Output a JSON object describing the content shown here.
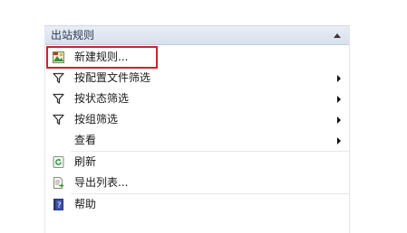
{
  "pane": {
    "title": "出站规则",
    "items": [
      {
        "label": "新建规则...",
        "icon": "new-rule-icon"
      },
      {
        "label": "按配置文件筛选",
        "icon": "filter-icon",
        "submenu": true
      },
      {
        "label": "按状态筛选",
        "icon": "filter-icon",
        "submenu": true
      },
      {
        "label": "按组筛选",
        "icon": "filter-icon",
        "submenu": true
      },
      {
        "label": "查看",
        "icon": null,
        "submenu": true
      },
      {
        "label": "刷新",
        "icon": "refresh-icon"
      },
      {
        "label": "导出列表...",
        "icon": "export-list-icon"
      },
      {
        "label": "帮助",
        "icon": "help-icon"
      }
    ]
  },
  "colors": {
    "highlight_border": "#c9252e",
    "header_text": "#2b3a55"
  }
}
